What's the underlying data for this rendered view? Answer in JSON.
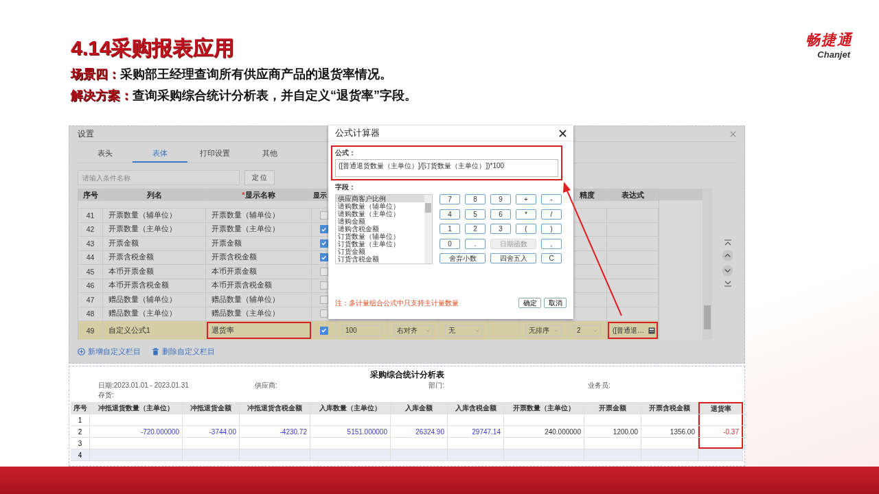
{
  "slide": {
    "title": "4.14采购报表应用",
    "lines": [
      "**场景四：**采购部王经理查询所有供应商产品的退货率情况。",
      "**解决方案：**查询采购综合统计分析表，并自定义“退货率”字段。"
    ],
    "logo": {
      "name": "畅捷通",
      "sub": "Chanjet"
    }
  },
  "settings": {
    "title": "设置",
    "tabs": [
      {
        "label": "表头",
        "selected": false
      },
      {
        "label": "表体",
        "selected": true
      },
      {
        "label": "打印设置",
        "selected": false
      },
      {
        "label": "其他",
        "selected": false
      }
    ],
    "search": {
      "placeholder": "请输入条件名称",
      "button": "定 位"
    },
    "columns": [
      {
        "label": "序号"
      },
      {
        "label": "列名"
      },
      {
        "label": "显示名称",
        "mark": "*"
      },
      {
        "label": "显示"
      },
      {},
      {},
      {},
      {},
      {},
      {
        "label": "精度"
      },
      {
        "label": "表达式"
      }
    ],
    "rows": [
      {
        "seq": "41",
        "name": "开票数量（辅单位）",
        "display": "开票数量（辅单位）",
        "shown": false,
        "selected": false
      },
      {
        "seq": "42",
        "name": "开票数量（主单位）",
        "display": "开票数量（主单位）",
        "shown": true,
        "selected": false
      },
      {
        "seq": "43",
        "name": "开票金额",
        "display": "开票金额",
        "shown": true,
        "selected": false
      },
      {
        "seq": "44",
        "name": "开票含税金额",
        "display": "开票含税金额",
        "shown": true,
        "selected": false
      },
      {
        "seq": "45",
        "name": "本币开票金额",
        "display": "本币开票金额",
        "shown": false,
        "selected": false
      },
      {
        "seq": "46",
        "name": "本币开票含税金额",
        "display": "本币开票含税金额",
        "shown": false,
        "selected": false
      },
      {
        "seq": "47",
        "name": "赠品数量（辅单位）",
        "display": "赠品数量（辅单位）",
        "shown": false,
        "selected": false
      },
      {
        "seq": "48",
        "name": "赠品数量（主单位）",
        "display": "赠品数量（主单位）",
        "shown": false,
        "selected": false
      },
      {
        "seq": "49",
        "name": "自定义公式1",
        "display": "退货率",
        "display_highlighted": true,
        "shown": true,
        "selected": true,
        "extra": [
          {
            "kind": "input",
            "value": "100"
          },
          {
            "kind": "select",
            "value": "右对齐"
          },
          {
            "kind": "select",
            "value": "无"
          },
          {
            "kind": "blank"
          },
          {
            "kind": "select",
            "value": "无排序"
          },
          {
            "kind": "select",
            "value": "2"
          },
          {
            "kind": "formula",
            "value": "([普通退…",
            "highlighted": true
          }
        ]
      }
    ],
    "actions": [
      {
        "kind": "add",
        "label": "新增自定义栏目"
      },
      {
        "kind": "delete",
        "label": "删除自定义栏目"
      }
    ]
  },
  "formula_dialog": {
    "title": "公式计算器",
    "formula_label": "公式：",
    "formula": "([普通退货数量（主单位）]/[订货数量（主单位）])*100",
    "formula_highlighted": true,
    "fields_label": "字段：",
    "fields": [
      {
        "label": "供应商客户比例",
        "selected": true
      },
      {
        "label": "请购数量（辅单位）",
        "selected": false
      },
      {
        "label": "请购数量（主单位）",
        "selected": false
      },
      {
        "label": "请购金额",
        "selected": false
      },
      {
        "label": "请购含税金额",
        "selected": false
      },
      {
        "label": "订货数量（辅单位）",
        "selected": false
      },
      {
        "label": "订货数量（主单位）",
        "selected": false
      },
      {
        "label": "订货金额",
        "selected": false
      },
      {
        "label": "订货含税金额",
        "selected": false
      }
    ],
    "keys": [
      {
        "label": "7"
      },
      {
        "label": "8"
      },
      {
        "label": "9"
      },
      {
        "label": "+"
      },
      {
        "label": "-"
      },
      {
        "label": "4"
      },
      {
        "label": "5"
      },
      {
        "label": "6"
      },
      {
        "label": "*"
      },
      {
        "label": "/"
      },
      {
        "label": "1"
      },
      {
        "label": "2"
      },
      {
        "label": "3"
      },
      {
        "label": "("
      },
      {
        "label": ")"
      },
      {
        "label": "0"
      },
      {
        "label": "."
      },
      {
        "label": "日期函数",
        "kind": "wide",
        "disabled": true
      },
      {
        "label": ","
      },
      {
        "label": "舍弃小数",
        "kind": "wide"
      },
      {
        "label": "四舍五入",
        "kind": "wide"
      },
      {
        "label": "C"
      }
    ],
    "note": "注：多计量组合公式中只支持主计量数量",
    "buttons": [
      "确定",
      "取消"
    ]
  },
  "report": {
    "title": "采购综合统计分析表",
    "filters": [
      {
        "label": "日期:",
        "value": "2023.01.01 - 2023.01.31"
      },
      {
        "label": "供应商:"
      },
      {
        "label": "部门:"
      },
      {
        "label": "业务员:"
      },
      {
        "label": "存货:"
      }
    ],
    "columns": [
      {
        "label": "序号",
        "kind": "index"
      },
      {
        "label": "冲抵退货数量（主单位）",
        "kind": "link"
      },
      {
        "label": "冲抵退货金额",
        "kind": "link"
      },
      {
        "label": "冲抵退货含税金额",
        "kind": "link"
      },
      {
        "label": "入库数量（主单位）",
        "kind": "link"
      },
      {
        "label": "入库金额",
        "kind": "link"
      },
      {
        "label": "入库含税金额",
        "kind": "link"
      },
      {
        "label": "开票数量（主单位）",
        "kind": "plain"
      },
      {
        "label": "开票金额",
        "kind": "plain"
      },
      {
        "label": "开票含税金额",
        "kind": "plain"
      },
      {
        "label": "退货率",
        "kind": "alert",
        "highlighted": true
      }
    ],
    "rows": [
      {
        "index": "1",
        "selected": false
      },
      {
        "index": "2",
        "selected": false,
        "values": [
          "-720.000000",
          "-3744.00",
          "-4230.72",
          "5151.000000",
          "26324.90",
          "29747.14",
          "240.000000",
          "1200.00",
          "1356.00",
          "-0.37"
        ]
      },
      {
        "index": "3",
        "selected": false
      },
      {
        "index": "4",
        "selected": true
      }
    ]
  }
}
